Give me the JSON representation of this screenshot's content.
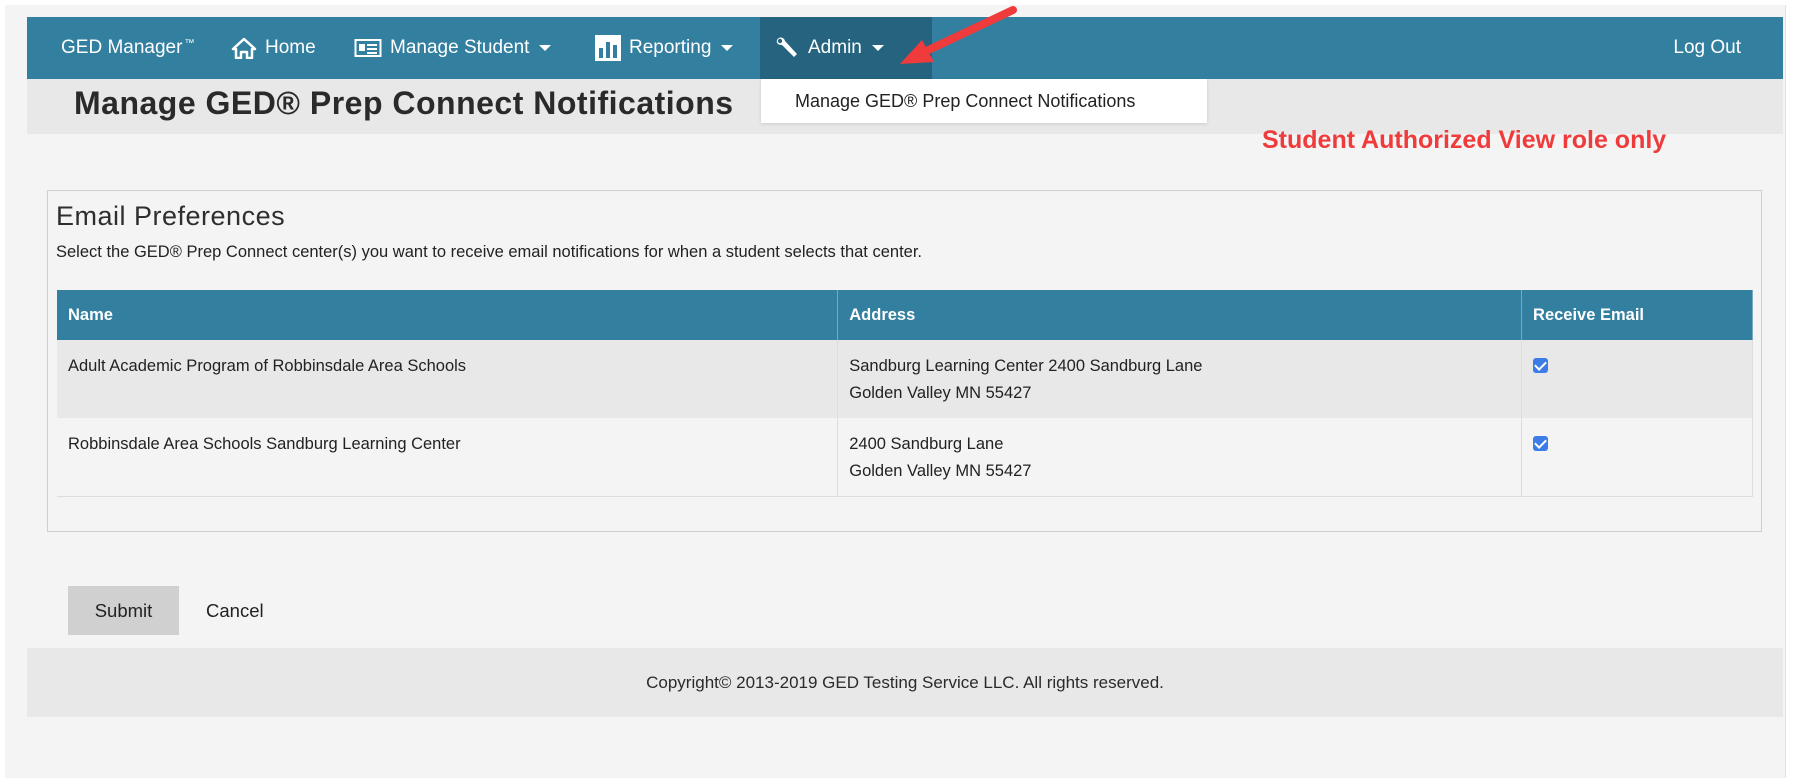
{
  "nav": {
    "brand": "GED Manager",
    "brand_tm": "™",
    "home": "Home",
    "manage_student": "Manage Student",
    "reporting": "Reporting",
    "admin": "Admin",
    "logout": "Log Out"
  },
  "dropdown": {
    "item": "Manage GED® Prep Connect Notifications"
  },
  "page": {
    "title": "Manage GED® Prep Connect Notifications"
  },
  "annotation": "Student Authorized View role only",
  "panel": {
    "heading": "Email Preferences",
    "description": "Select the GED® Prep Connect center(s) you want to receive email notifications for when a student selects that center."
  },
  "table": {
    "headers": [
      "Name",
      "Address",
      "Receive Email"
    ],
    "rows": [
      {
        "name": "Adult Academic Program of Robbinsdale Area Schools",
        "address_line1": "Sandburg Learning Center 2400 Sandburg Lane",
        "address_line2": "Golden Valley MN 55427",
        "receive_email": true
      },
      {
        "name": "Robbinsdale Area Schools Sandburg Learning Center",
        "address_line1": "2400 Sandburg Lane",
        "address_line2": "Golden Valley MN 55427",
        "receive_email": true
      }
    ]
  },
  "buttons": {
    "submit": "Submit",
    "cancel": "Cancel"
  },
  "footer": {
    "copyright": "Copyright© 2013-2019 GED Testing Service LLC. All rights reserved."
  },
  "colors": {
    "nav_bg": "#337fa0",
    "nav_active_bg": "#25637f",
    "annotation": "#ef3b3b",
    "checkbox": "#3b7ce6"
  },
  "icons": [
    "home-icon",
    "id-card-icon",
    "bar-chart-icon",
    "wrench-icon",
    "caret-down-icon",
    "arrow-annotation"
  ]
}
